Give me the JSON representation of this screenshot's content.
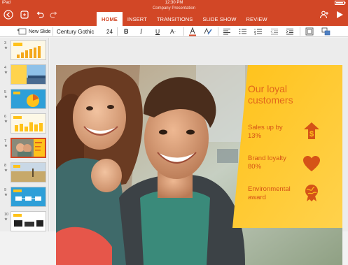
{
  "status_bar": {
    "device": "iPad",
    "time": "12:30 PM",
    "battery": "100%"
  },
  "document": {
    "title": "Company Presentation"
  },
  "tabs": [
    {
      "label": "HOME",
      "active": true
    },
    {
      "label": "INSERT",
      "active": false
    },
    {
      "label": "TRANSITIONS",
      "active": false
    },
    {
      "label": "SLIDE SHOW",
      "active": false
    },
    {
      "label": "REVIEW",
      "active": false
    }
  ],
  "toolbar_icons": [
    "back-icon",
    "file-icon",
    "undo-icon",
    "redo-icon",
    "add-person-icon",
    "play-icon"
  ],
  "ribbon": {
    "new_slide_label": "New Slide",
    "font_name": "Century Gothic",
    "font_size": "24",
    "bold": "B",
    "italic": "I",
    "underline": "U",
    "font_effects": "A"
  },
  "thumbnails": [
    {
      "number": "3",
      "star": "★"
    },
    {
      "number": "4",
      "star": "★"
    },
    {
      "number": "5",
      "star": "★"
    },
    {
      "number": "6",
      "star": "★"
    },
    {
      "number": "7",
      "star": "★",
      "selected": true
    },
    {
      "number": "8",
      "star": "★"
    },
    {
      "number": "9",
      "star": "★"
    },
    {
      "number": "10",
      "star": "★"
    }
  ],
  "slide": {
    "heading_line1": "Our loyal",
    "heading_line2": "customers",
    "stats": [
      {
        "line1": "Sales up by",
        "line2": "13%",
        "icon": "dollar-arrow-icon"
      },
      {
        "line1": "Brand loyalty",
        "line2": "80%",
        "icon": "heart-icon"
      },
      {
        "line1": "Environmental",
        "line2": "award",
        "icon": "globe-ribbon-icon"
      }
    ]
  },
  "colors": {
    "accent": "#d24726",
    "panel_yellow": "#ffc21a",
    "slide_text_orange": "#e1661b"
  }
}
